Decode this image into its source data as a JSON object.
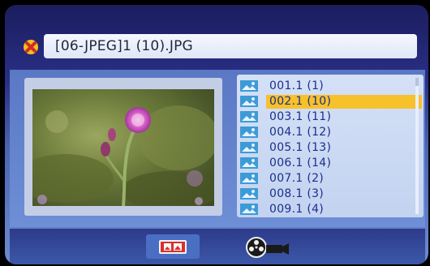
{
  "header": {
    "filename": "[06-JPEG]1 (10).JPG"
  },
  "file_list": {
    "items": [
      {
        "label": "001.1 (1)",
        "selected": false
      },
      {
        "label": "002.1 (10)",
        "selected": true
      },
      {
        "label": "003.1 (11)",
        "selected": false
      },
      {
        "label": "004.1 (12)",
        "selected": false
      },
      {
        "label": "005.1 (13)",
        "selected": false
      },
      {
        "label": "006.1 (14)",
        "selected": false
      },
      {
        "label": "007.1 (2)",
        "selected": false
      },
      {
        "label": "008.1 (3)",
        "selected": false
      },
      {
        "label": "009.1 (4)",
        "selected": false
      }
    ],
    "selected_color": "#f6c12a"
  },
  "icons": {
    "file_type": "jpeg-file-icon",
    "photo_mode": "photo-mode-icon",
    "video_mode": "film-reel-icon"
  }
}
